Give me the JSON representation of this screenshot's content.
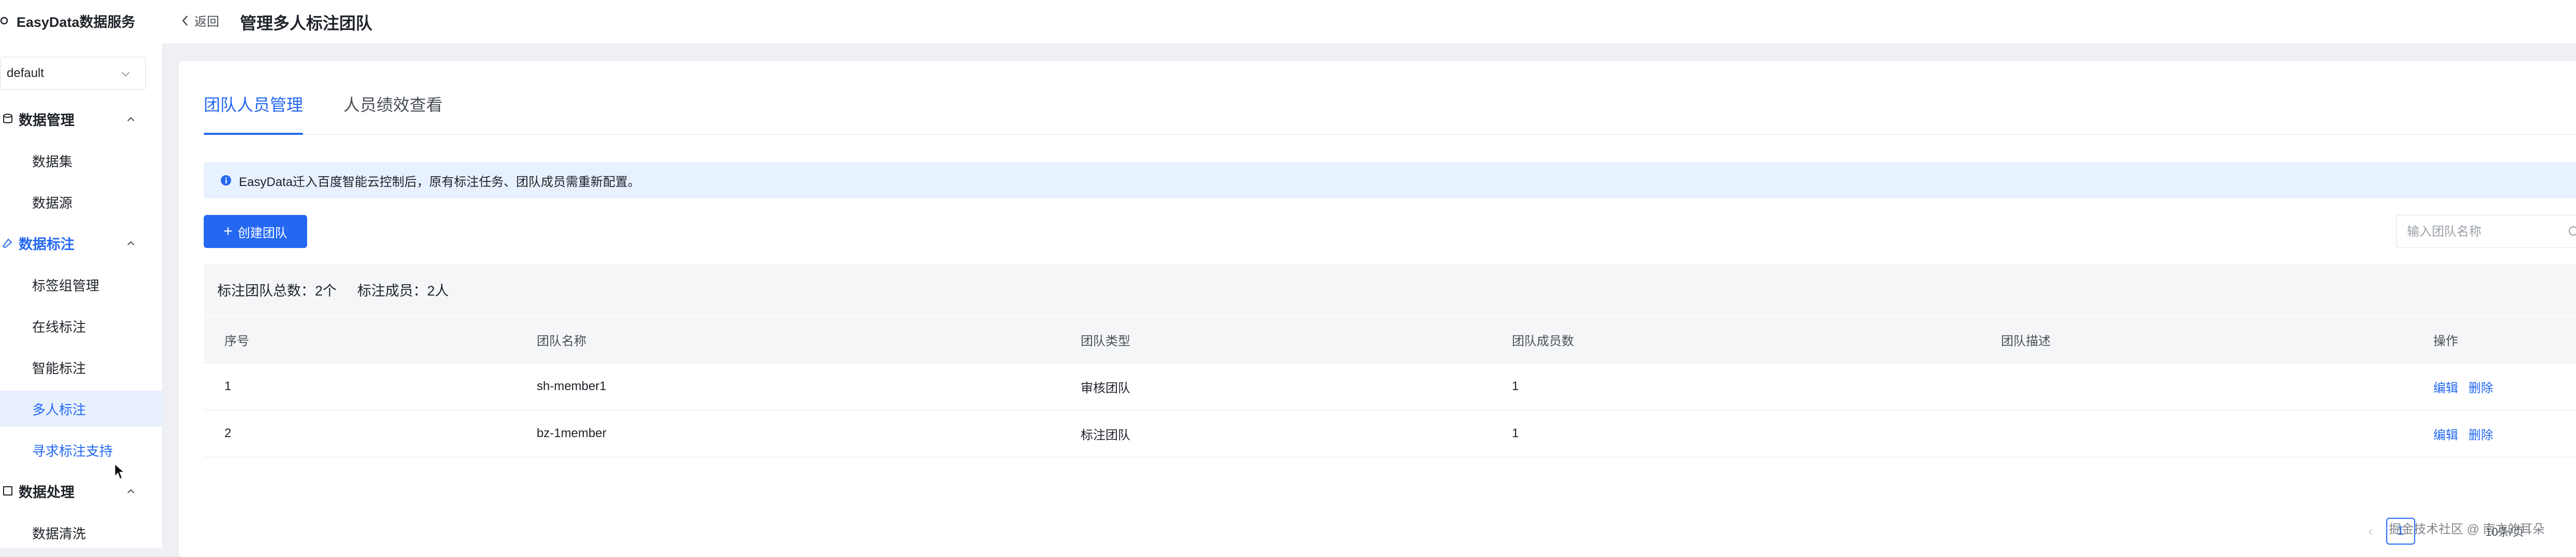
{
  "sidebar": {
    "brand": "EasyData数据服务",
    "env_select": "default",
    "groups": [
      {
        "label": "数据管理",
        "items": [
          "数据集",
          "数据源"
        ]
      },
      {
        "label": "数据标注",
        "items": [
          "标签组管理",
          "在线标注",
          "智能标注",
          "多人标注",
          "寻求标注支持"
        ]
      },
      {
        "label": "数据处理",
        "items": [
          "数据清洗"
        ]
      }
    ]
  },
  "header": {
    "back_label": "返回",
    "title": "管理多人标注团队"
  },
  "main": {
    "tabs": [
      "团队人员管理",
      "人员绩效查看"
    ],
    "notice": "EasyData迁入百度智能云控制后，原有标注任务、团队成员需重新配置。",
    "create_button": "创建团队",
    "search_placeholder": "输入团队名称",
    "summary": {
      "total_teams": "标注团队总数：2个",
      "total_members": "标注成员：2人"
    },
    "table": {
      "columns": [
        "序号",
        "团队名称",
        "团队类型",
        "团队成员数",
        "团队描述",
        "操作"
      ],
      "rows": [
        {
          "index": "1",
          "name": "sh-member1",
          "type": "审核团队",
          "members": "1",
          "desc": "",
          "edit": "编辑",
          "delete": "删除"
        },
        {
          "index": "2",
          "name": "bz-1member",
          "type": "标注团队",
          "members": "1",
          "desc": "",
          "edit": "编辑",
          "delete": "删除"
        }
      ]
    },
    "pagination": {
      "current_page": "1",
      "page_size": "10条/页"
    }
  },
  "watermark": "掘金技术社区 @ 南方的耳朵",
  "colors": {
    "accent": "#2468f2",
    "notice_bg": "#e8f1ff",
    "page_bg": "#eef0f4"
  }
}
